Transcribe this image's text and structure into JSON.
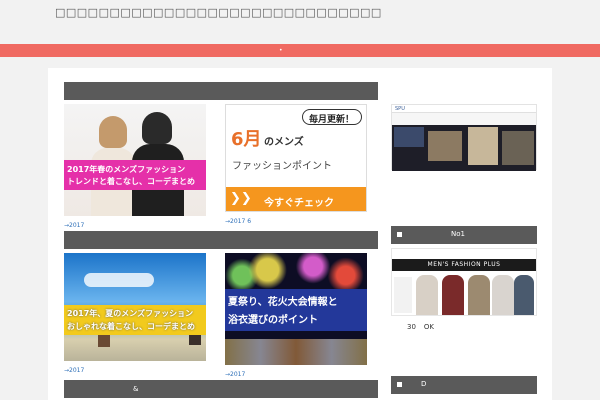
{
  "header": {
    "title": "□□□□□□□□□□□□□□□□□□□□□□□□□□□□□□",
    "nav_dot": "•"
  },
  "main": {
    "section_bars": [
      {
        "label": ""
      },
      {
        "label": ""
      },
      {
        "label": "&"
      }
    ],
    "posts": [
      {
        "caption_lines": [
          "2017年春のメンズファッション",
          "トレンドと着こなし、コーデまとめ"
        ],
        "meta": "→2017"
      },
      {
        "bubble": "毎月更新！",
        "big": "6月",
        "big_suffix": "のメンズ",
        "sub": "ファッションポイント",
        "cta_arrows": "❯❯",
        "cta": "今すぐチェック",
        "meta": "→2017 6"
      },
      {
        "caption_lines": [
          "2017年、夏のメンズファッション",
          "おしゃれな着こなし、コーデまとめ"
        ],
        "meta": "→2017"
      },
      {
        "caption_lines": [
          "夏祭り、花火大会情報と",
          "浴衣選びのポイント"
        ],
        "meta": "→2017"
      }
    ]
  },
  "sidebar": {
    "ad_top": {
      "logo": "SPU"
    },
    "widget_no1": {
      "label": "No1"
    },
    "ad_brand": {
      "name": "MEN'S FASHION PLUS"
    },
    "stats": {
      "num": "30",
      "ok": "OK"
    },
    "widget_d": {
      "label": "D"
    }
  }
}
